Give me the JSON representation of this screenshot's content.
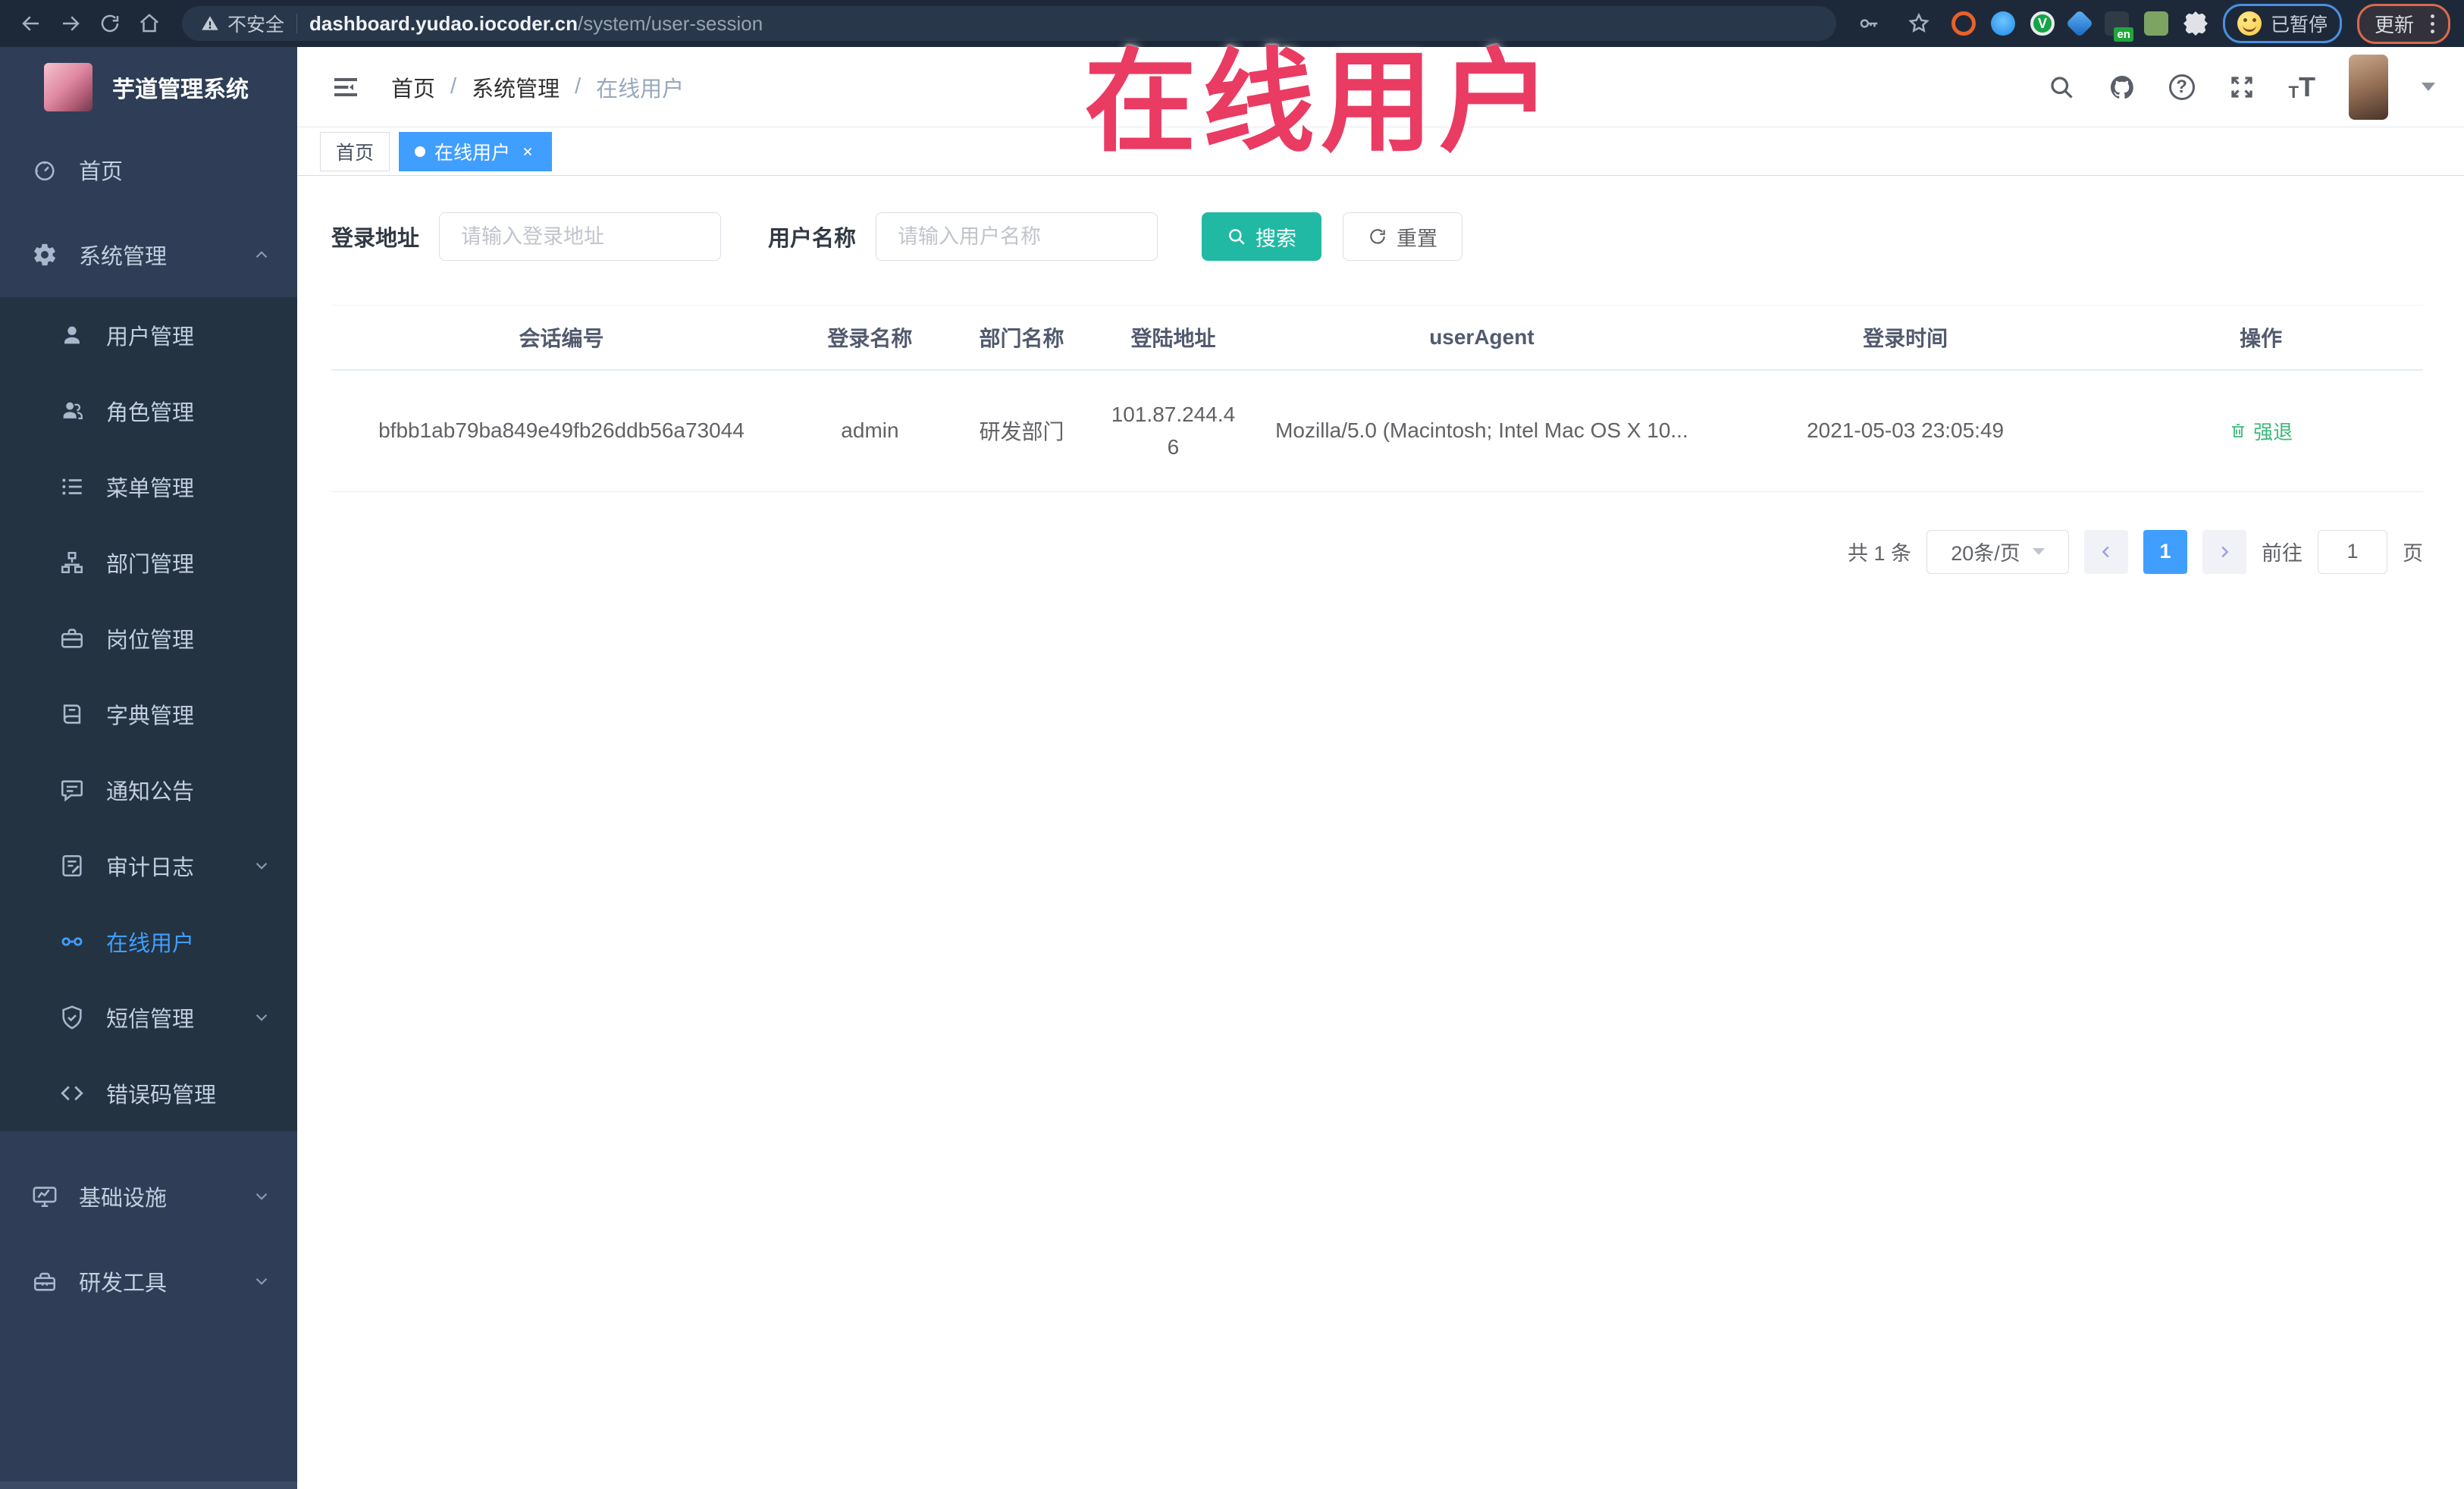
{
  "browser": {
    "security_label": "不安全",
    "url_host": "dashboard.yudao.iocoder.cn",
    "url_path": "/system/user-session",
    "extension_en_badge": "en",
    "paused_badge_label": "已暂停",
    "update_button_label": "更新"
  },
  "watermark_text": "在线用户",
  "sidebar": {
    "logo_title": "芋道管理系统",
    "items": [
      {
        "label": "首页"
      },
      {
        "label": "系统管理"
      },
      {
        "label": "用户管理"
      },
      {
        "label": "角色管理"
      },
      {
        "label": "菜单管理"
      },
      {
        "label": "部门管理"
      },
      {
        "label": "岗位管理"
      },
      {
        "label": "字典管理"
      },
      {
        "label": "通知公告"
      },
      {
        "label": "审计日志"
      },
      {
        "label": "在线用户"
      },
      {
        "label": "短信管理"
      },
      {
        "label": "错误码管理"
      },
      {
        "label": "基础设施"
      },
      {
        "label": "研发工具"
      }
    ]
  },
  "header": {
    "breadcrumb": [
      "首页",
      "系统管理",
      "在线用户"
    ],
    "breadcrumb_separator": "/",
    "help_glyph": "?",
    "fontsize_glyph": "T"
  },
  "tabs": [
    {
      "label": "首页"
    },
    {
      "label": "在线用户"
    }
  ],
  "filters": {
    "login_address_label": "登录地址",
    "login_address_placeholder": "请输入登录地址",
    "user_name_label": "用户名称",
    "user_name_placeholder": "请输入用户名称",
    "search_label": "搜索",
    "reset_label": "重置"
  },
  "table": {
    "columns": [
      "会话编号",
      "登录名称",
      "部门名称",
      "登陆地址",
      "userAgent",
      "登录时间",
      "操作"
    ],
    "rows": [
      {
        "session_id": "bfbb1ab79ba849e49fb26ddb56a73044",
        "login_name": "admin",
        "dept_name": "研发部门",
        "login_address": "101.87.244.46",
        "user_agent": "Mozilla/5.0 (Macintosh; Intel Mac OS X 10...",
        "login_time": "2021-05-03 23:05:49",
        "action_label": "强退"
      }
    ]
  },
  "pagination": {
    "total_label": "共 1 条",
    "page_size_label": "20条/页",
    "current_page": "1",
    "goto_label": "前往",
    "goto_value": "1",
    "page_unit_label": "页"
  },
  "colors": {
    "accent_blue": "#409eff",
    "search_teal": "#21b9a4",
    "action_green": "#3db87a",
    "watermark_red": "#ea3b62",
    "sidebar_bg": "#2f3e56",
    "submenu_bg": "#243341",
    "toolbar_bg": "#1d2939"
  }
}
